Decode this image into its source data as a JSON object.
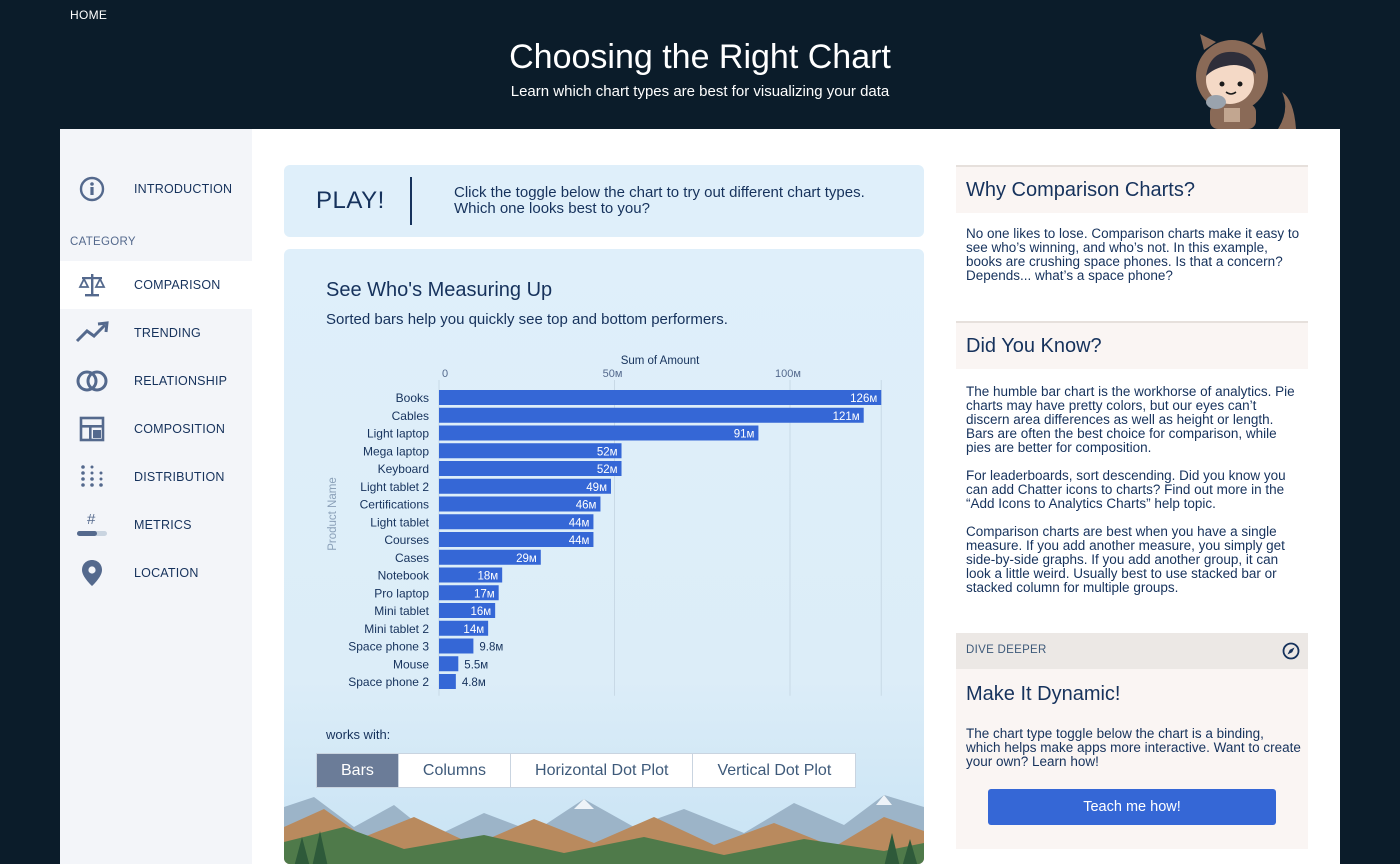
{
  "header": {
    "home_link": "HOME",
    "title": "Choosing the Right Chart",
    "subtitle": "Learn which chart types are best for visualizing your data"
  },
  "sidebar": {
    "category_label": "CATEGORY",
    "items": [
      {
        "label": "INTRODUCTION",
        "icon": "info-icon",
        "active": false
      },
      {
        "label": "COMPARISON",
        "icon": "scale-icon",
        "active": true
      },
      {
        "label": "TRENDING",
        "icon": "trend-line-icon",
        "active": false
      },
      {
        "label": "RELATIONSHIP",
        "icon": "overlap-circles-icon",
        "active": false
      },
      {
        "label": "COMPOSITION",
        "icon": "layout-icon",
        "active": false
      },
      {
        "label": "DISTRIBUTION",
        "icon": "dot-grid-icon",
        "active": false
      },
      {
        "label": "METRICS",
        "icon": "hash-metric-icon",
        "active": false
      },
      {
        "label": "LOCATION",
        "icon": "map-pin-icon",
        "active": false
      }
    ]
  },
  "play": {
    "label": "PLAY!",
    "text": "Click the toggle below the chart to try out different chart types. Which one looks best to you?"
  },
  "chart_panel": {
    "title": "See Who's Measuring Up",
    "subtitle": "Sorted bars help you quickly see top and bottom performers.",
    "works_with": "works with:",
    "toggles": [
      "Bars",
      "Columns",
      "Horizontal Dot Plot",
      "Vertical Dot Plot"
    ],
    "active_toggle": "Bars"
  },
  "chart_data": {
    "type": "bar",
    "orientation": "horizontal",
    "title": "",
    "xlabel": "Sum of Amount",
    "ylabel": "Product Name",
    "x_ticks": [
      "0",
      "50м",
      "100м"
    ],
    "x_tick_values": [
      0,
      50,
      100
    ],
    "xlim": [
      0,
      126
    ],
    "grid": true,
    "bar_color": "#3567d6",
    "categories": [
      "Books",
      "Cables",
      "Light laptop",
      "Mega laptop",
      "Keyboard",
      "Light tablet 2",
      "Certifications",
      "Light tablet",
      "Courses",
      "Cases",
      "Notebook",
      "Pro laptop",
      "Mini tablet",
      "Mini tablet 2",
      "Space phone 3",
      "Mouse",
      "Space phone 2"
    ],
    "values": [
      126,
      121,
      91,
      52,
      52,
      49,
      46,
      44,
      44,
      29,
      18,
      17,
      16,
      14,
      9.8,
      5.5,
      4.8
    ],
    "value_labels": [
      "126м",
      "121м",
      "91м",
      "52м",
      "52м",
      "49м",
      "46м",
      "44м",
      "44м",
      "29м",
      "18м",
      "17м",
      "16м",
      "14м",
      "9.8м",
      "5.5м",
      "4.8м"
    ]
  },
  "why_card": {
    "title": "Why Comparison Charts?",
    "body": "No one likes to lose. Comparison charts make it easy to see who’s winning, and who’s not. In this example, books are crushing space phones. Is that a concern? Depends... what’s a space phone?"
  },
  "know_card": {
    "title": "Did You Know?",
    "paragraphs": [
      "The humble bar chart is the workhorse of analytics. Pie charts may have pretty colors, but our eyes can’t discern area differences as well as height or length. Bars are often the best choice for comparison, while pies are better for composition.",
      "For leaderboards, sort descending. Did you know you can add Chatter icons to charts? Find out more in the “Add Icons to Analytics Charts” help topic.",
      "Comparison charts are best when you have a single measure. If you add another measure, you simply get side-by-side graphs. If you add another group, it can look a little weird. Usually best to use stacked bar or stacked column for multiple groups."
    ]
  },
  "deeper_card": {
    "label": "DIVE DEEPER",
    "icon": "compass-icon",
    "title": "Make It Dynamic!",
    "text": "The chart type toggle below the chart is a binding, which helps make apps more interactive. Want to create your own? Learn how!",
    "button_label": "Teach me how!"
  }
}
